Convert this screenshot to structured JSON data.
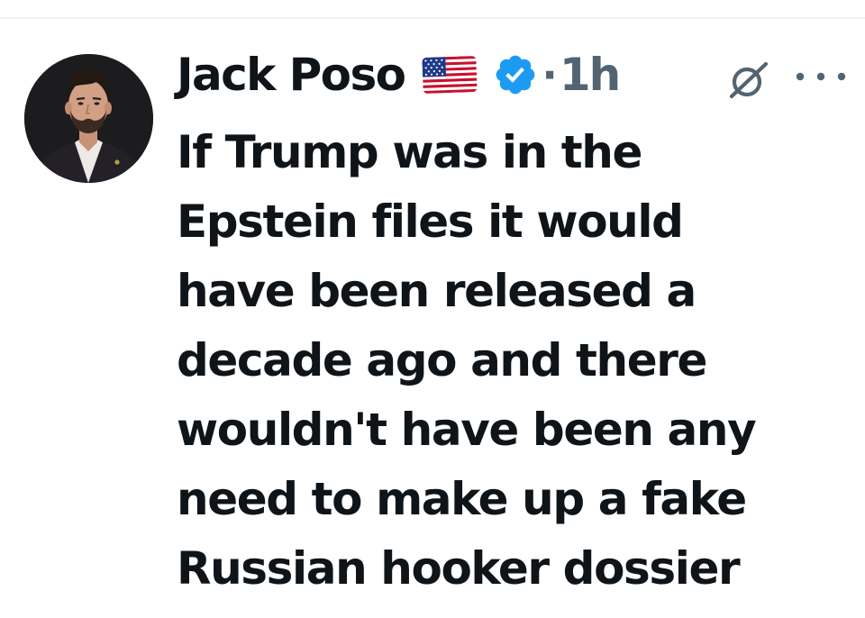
{
  "tweet": {
    "author": {
      "display_name": "Jack Poso",
      "avatar_icon": "profile-photo",
      "flag_icon": "us-flag-emoji",
      "verified_icon": "verified-badge-icon"
    },
    "separator": "·",
    "timestamp": "1h",
    "actions": {
      "grok_icon": "grok-icon",
      "more_icon": "more-options-icon"
    },
    "text_lines": [
      "If Trump was in the",
      "Epstein files it would",
      "have been released a",
      "decade ago and there",
      "wouldn't have been any",
      "need to make up a fake",
      "Russian hooker dossier"
    ]
  },
  "colors": {
    "text_primary": "#0f1419",
    "text_secondary": "#536471",
    "verified_blue": "#1d9bf0",
    "divider": "#eff3f4",
    "background": "#ffffff"
  }
}
